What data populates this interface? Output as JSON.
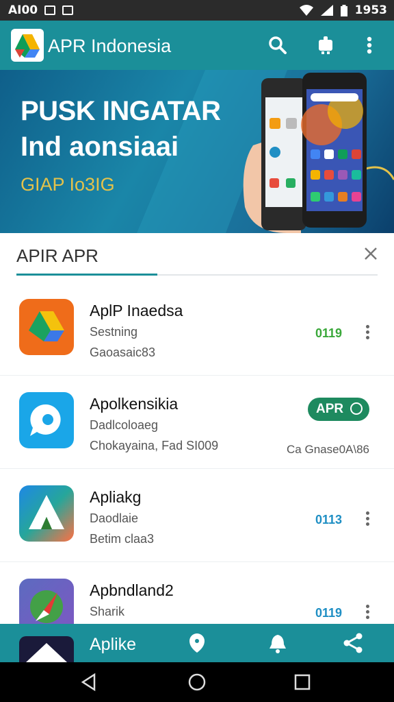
{
  "status_bar": {
    "left_text": "AI00",
    "right_text": "1953"
  },
  "app_bar": {
    "title": "APR Indonesia"
  },
  "banner": {
    "headline_1": "PUSK INGATAR",
    "headline_2": "Ind aonsiaai",
    "tagline": "GIAP Io3IG"
  },
  "panel": {
    "label": "APIR APR"
  },
  "apps": [
    {
      "name": "AplP Inaedsa",
      "line1": "Sestning",
      "line2": "Gaoasaic83",
      "value": "0119",
      "value_color": "#3aa83a"
    },
    {
      "name": "Apolkensikia",
      "line1": "Dadlcoloaeg",
      "line2": "Chokayaina, Fad SI009",
      "badge": "APR",
      "extra": "Ca Gnase0A\\86"
    },
    {
      "name": "Apliakg",
      "line1": "Daodlaie",
      "line2": "Betim claa3",
      "value": "0113",
      "value_color": "#1f8fc4"
    },
    {
      "name": "Apbndland2",
      "line1": "Sharik",
      "value": "0119",
      "value_color": "#1f8fc4"
    }
  ],
  "bottom_nav": {
    "label": "Aplike"
  },
  "colors": {
    "primary": "#1b8f99",
    "status_bar": "#2b2b2b",
    "banner_accent": "#e4c24a"
  }
}
